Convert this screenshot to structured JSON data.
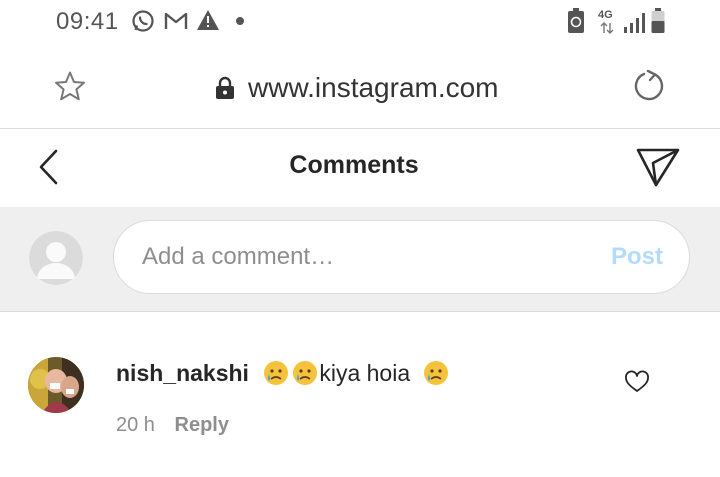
{
  "status_bar": {
    "time": "09:41",
    "network_label": "4G",
    "icons": [
      "whatsapp-icon",
      "gmail-icon",
      "warning-icon",
      "notification-dot-icon",
      "recycle-icon",
      "signal-icon",
      "battery-icon"
    ]
  },
  "browser": {
    "url": "www.instagram.com",
    "icons": [
      "star-icon",
      "lock-icon",
      "reload-icon"
    ]
  },
  "header": {
    "title": "Comments",
    "icons": [
      "back-arrow-icon",
      "send-icon"
    ]
  },
  "compose": {
    "placeholder": "Add a comment…",
    "post_label": "Post",
    "post_color": "#b3dbff"
  },
  "comments": [
    {
      "username": "nish_nakshi",
      "emoji_before": "😢😢",
      "text": "kiya hoia",
      "emoji_after": "😢",
      "time": "20 h",
      "reply_label": "Reply"
    }
  ],
  "colors": {
    "text": "#262626",
    "secondary_text": "#8e8e8e",
    "compose_bg": "#efefef",
    "divider": "#dbdbdb"
  }
}
